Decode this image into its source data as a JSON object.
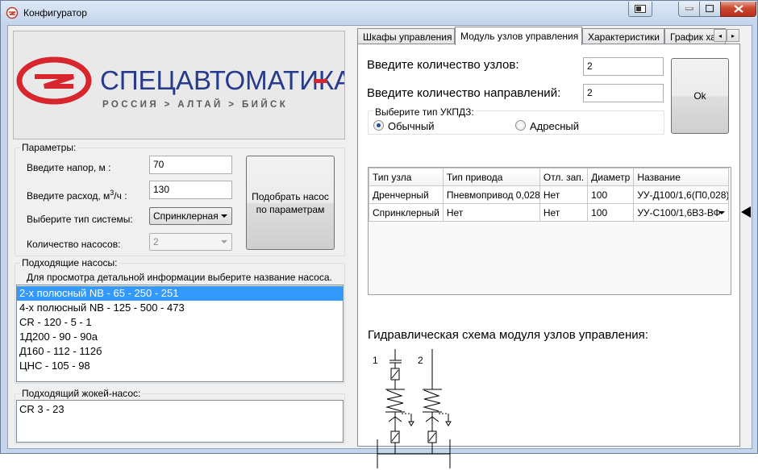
{
  "window": {
    "title": "Конфигуратор",
    "controls": {
      "minimize": "minimize-icon",
      "maximize": "maximize-icon",
      "close": "close-icon"
    }
  },
  "logo": {
    "company": "СПЕЦАВТОМАТИКА",
    "tagline": "РОССИЯ > АЛТАЙ > БИЙСК",
    "colors": {
      "red": "#d7262e",
      "blue": "#273a8c"
    }
  },
  "params": {
    "group_title": "Параметры:",
    "head_label": "Введите напор, м :",
    "head_value": "70",
    "flow_label": "Введите расход, м",
    "flow_sup": "3",
    "flow_suffix": "/ч :",
    "flow_value": "130",
    "system_label": "Выберите тип системы:",
    "system_value": "Спринклерная",
    "pumps_count_label": "Количество насосов:",
    "pumps_count_value": "2",
    "select_button": "Подобрать насос по параметрам"
  },
  "pumps": {
    "group_title": "Подходящие насосы:",
    "hint": "Для просмотра детальной информации выберите название насоса.",
    "items": [
      "2-х полюсный NB - 65 - 250 - 251",
      "4-х полюсный NB - 125 - 500 - 473",
      "CR - 120 - 5 - 1",
      "1Д200 - 90 - 90а",
      "Д160 - 112 - 112б",
      "ЦНС - 105 - 98"
    ],
    "selected_index": 0
  },
  "jockey": {
    "group_title": "Подходящий жокей-насос:",
    "value": "CR 3 - 23"
  },
  "tabs": [
    "Шкафы управления",
    "Модуль узлов управления",
    "Характеристики",
    "График ха"
  ],
  "active_tab": 1,
  "module": {
    "nodes_label": "Введите количество узлов:",
    "nodes_value": "2",
    "directions_label": "Введите количество направлений:",
    "directions_value": "2",
    "ok_button": "Ok",
    "type_group_title": "Выберите тип УКПДЗ:",
    "type_options": [
      "Обычный",
      "Адресный"
    ],
    "type_selected": 0,
    "table": {
      "headers": [
        "Тип узла",
        "Тип привода",
        "Отл. зап.",
        "Диаметр",
        "Название"
      ],
      "rows": [
        [
          "Дренчерный",
          "Пневмопривод 0,028",
          "Нет",
          "100",
          "УУ-Д100/1,6(П0,028)-"
        ],
        [
          "Спринклерный",
          "Нет",
          "Нет",
          "100",
          "УУ-С100/1,6В3-ВФ"
        ]
      ]
    },
    "scheme_title": "Гидравлическая схема модуля узлов управления:",
    "scheme_labels": [
      "1",
      "2"
    ]
  }
}
